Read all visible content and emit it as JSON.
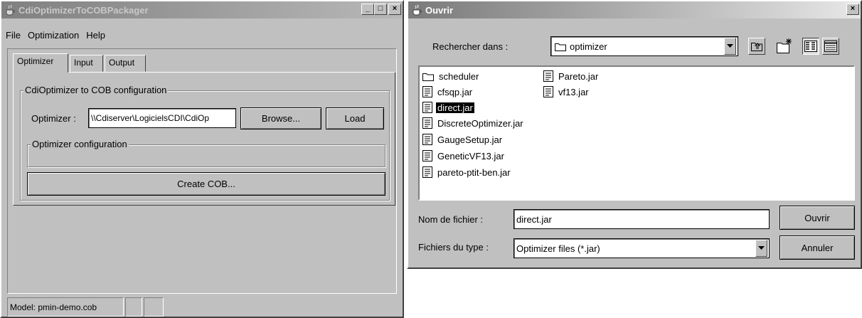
{
  "packager": {
    "title": "CdiOptimizerToCOBPackager",
    "controls": {
      "minimize": "_",
      "maximize": "□",
      "close": "×"
    },
    "menu": [
      "File",
      "Optimization",
      "Help"
    ],
    "tabs": [
      "Optimizer",
      "Input",
      "Output"
    ],
    "config_group_label": "CdiOptimizer to COB configuration",
    "optimizer_label": "Optimizer :",
    "optimizer_path": "\\\\Cdiserver\\LogicielsCDI\\CdiOp",
    "browse_label": "Browse...",
    "load_label": "Load",
    "optimizer_config_label": "Optimizer configuration",
    "create_cob_label": "Create COB...",
    "status_text": "Model: pmin-demo.cob"
  },
  "open_dialog": {
    "title": "Ouvrir",
    "close": "×",
    "look_in_label": "Rechercher dans :",
    "look_in_value": "optimizer",
    "files_col1": [
      "scheduler",
      "cfsqp.jar",
      "direct.jar",
      "DiscreteOptimizer.jar",
      "GaugeSetup.jar",
      "GeneticVF13.jar",
      "pareto-ptit-ben.jar"
    ],
    "files_col2": [
      "Pareto.jar",
      "vf13.jar"
    ],
    "selected_file": "direct.jar",
    "file_name_label": "Nom de fichier :",
    "file_name_value": "direct.jar",
    "file_type_label": "Fichiers du type :",
    "file_type_value": "Optimizer files (*.jar)",
    "open_button": "Ouvrir",
    "cancel_button": "Annuler"
  },
  "icons": {
    "app": "java-cup-icon",
    "folder": "folder-icon",
    "file": "jar-file-icon",
    "up_folder": "up-folder-icon",
    "new_folder": "new-folder-icon",
    "list_view": "list-view-icon",
    "details_view": "details-view-icon"
  }
}
